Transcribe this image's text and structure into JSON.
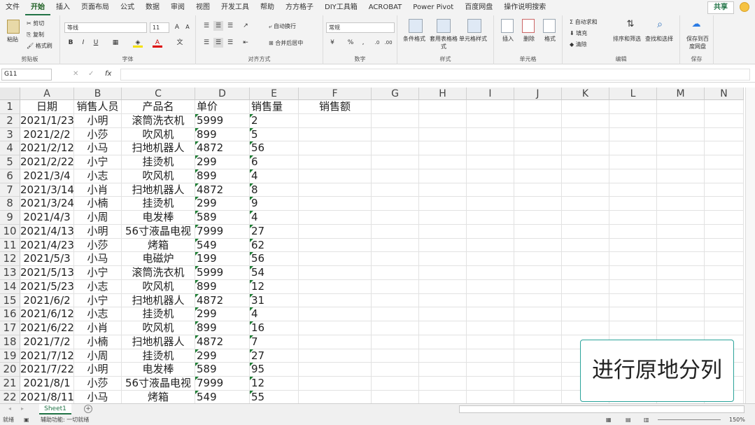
{
  "menu": {
    "tabs": [
      "文件",
      "开始",
      "插入",
      "页面布局",
      "公式",
      "数据",
      "审阅",
      "视图",
      "开发工具",
      "帮助",
      "方方格子",
      "DIY工具箱",
      "ACROBAT",
      "Power Pivot",
      "百度网盘",
      "操作说明搜索"
    ],
    "share_label": "共享"
  },
  "ribbon": {
    "clipboard": {
      "paste": "粘贴",
      "cut": "剪切",
      "copy": "复制",
      "format_painter": "格式刷",
      "label": "剪贴板"
    },
    "font": {
      "name": "等线",
      "size": "11",
      "label": "字体",
      "bold": "B",
      "italic": "I",
      "underline": "U"
    },
    "alignment": {
      "wrap": "自动换行",
      "merge": "合并后居中",
      "label": "对齐方式"
    },
    "number": {
      "format": "常规",
      "label": "数字",
      "percent": "%"
    },
    "styles": {
      "conditional": "条件格式",
      "table": "套用表格格式",
      "cell_styles": "单元格样式",
      "label": "样式"
    },
    "cells": {
      "insert": "插入",
      "delete": "删除",
      "format": "格式",
      "label": "单元格"
    },
    "editing": {
      "autosum": "自动求和",
      "fill": "填充",
      "clear": "清除",
      "sort": "排序和筛选",
      "find": "查找和选择",
      "label": "编辑"
    },
    "save": {
      "save_to": "保存到百度网盘",
      "label": "保存"
    }
  },
  "formula_bar": {
    "name_box": "G11",
    "fx": "fx",
    "formula": ""
  },
  "grid": {
    "columns": [
      "A",
      "B",
      "C",
      "D",
      "E",
      "F",
      "G",
      "H",
      "I",
      "J",
      "K",
      "L",
      "M",
      "N"
    ],
    "rows": [
      [
        "日期",
        "销售人员",
        "产品名",
        "单价",
        "销售量",
        "销售额"
      ],
      [
        "2021/1/23",
        "小明",
        "滚筒洗衣机",
        "5999",
        "2",
        ""
      ],
      [
        "2021/2/2",
        "小莎",
        "吹风机",
        "899",
        "5",
        ""
      ],
      [
        "2021/2/12",
        "小马",
        "扫地机器人",
        "4872",
        "56",
        ""
      ],
      [
        "2021/2/22",
        "小宁",
        "挂烫机",
        "299",
        "6",
        ""
      ],
      [
        "2021/3/4",
        "小志",
        "吹风机",
        "899",
        "4",
        ""
      ],
      [
        "2021/3/14",
        "小肖",
        "扫地机器人",
        "4872",
        "8",
        ""
      ],
      [
        "2021/3/24",
        "小楠",
        "挂烫机",
        "299",
        "9",
        ""
      ],
      [
        "2021/4/3",
        "小周",
        "电发棒",
        "589",
        "4",
        ""
      ],
      [
        "2021/4/13",
        "小明",
        "56寸液晶电视",
        "7999",
        "27",
        ""
      ],
      [
        "2021/4/23",
        "小莎",
        "烤箱",
        "549",
        "62",
        ""
      ],
      [
        "2021/5/3",
        "小马",
        "电磁炉",
        "199",
        "56",
        ""
      ],
      [
        "2021/5/13",
        "小宁",
        "滚筒洗衣机",
        "5999",
        "54",
        ""
      ],
      [
        "2021/5/23",
        "小志",
        "吹风机",
        "899",
        "12",
        ""
      ],
      [
        "2021/6/2",
        "小宁",
        "扫地机器人",
        "4872",
        "31",
        ""
      ],
      [
        "2021/6/12",
        "小志",
        "挂烫机",
        "299",
        "4",
        ""
      ],
      [
        "2021/6/22",
        "小肖",
        "吹风机",
        "899",
        "16",
        ""
      ],
      [
        "2021/7/2",
        "小楠",
        "扫地机器人",
        "4872",
        "7",
        ""
      ],
      [
        "2021/7/12",
        "小周",
        "挂烫机",
        "299",
        "27",
        ""
      ],
      [
        "2021/7/22",
        "小明",
        "电发棒",
        "589",
        "95",
        ""
      ],
      [
        "2021/8/1",
        "小莎",
        "56寸液晶电视",
        "7999",
        "12",
        ""
      ],
      [
        "2021/8/11",
        "小马",
        "烤箱",
        "549",
        "55",
        ""
      ]
    ]
  },
  "caption": "进行原地分列",
  "sheets": {
    "active": "Sheet1",
    "add": "+"
  },
  "status": {
    "ready": "就绪",
    "accessibility": "辅助功能: 一切就绪",
    "zoom": "150%"
  }
}
